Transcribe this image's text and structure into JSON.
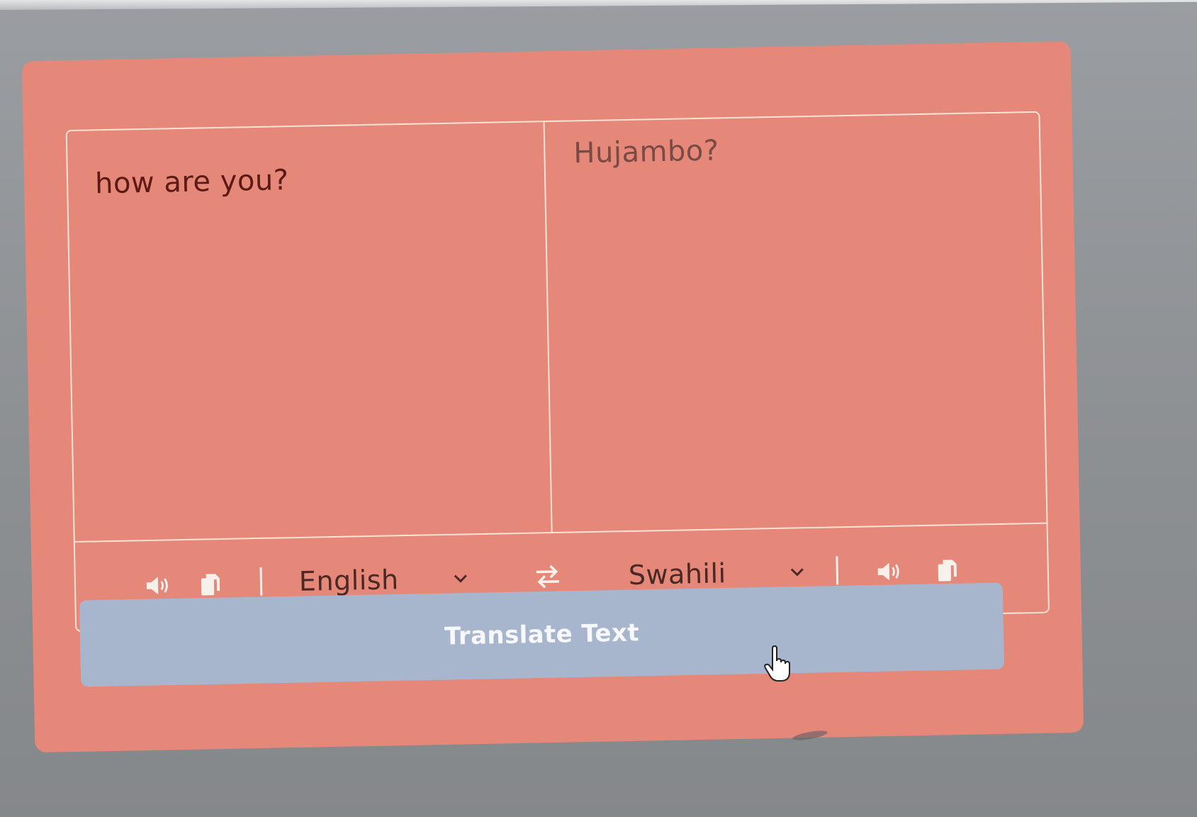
{
  "translator": {
    "from_text": "how are you?",
    "to_text": "Hujambo?",
    "from_language": "English",
    "to_language": "Swahili",
    "translate_button": "Translate Text"
  },
  "icons": {
    "speak_from": "volume-icon",
    "copy_from": "copy-icon",
    "exchange": "exchange-icon",
    "speak_to": "volume-icon",
    "copy_to": "copy-icon",
    "cursor": "pointer-hand-cursor"
  },
  "colors": {
    "card_background": "#e5887a",
    "border": "#fbe3d3",
    "button_background": "#a7b6cc",
    "button_text": "#f7f8fb",
    "page_background": "#8f9295"
  }
}
